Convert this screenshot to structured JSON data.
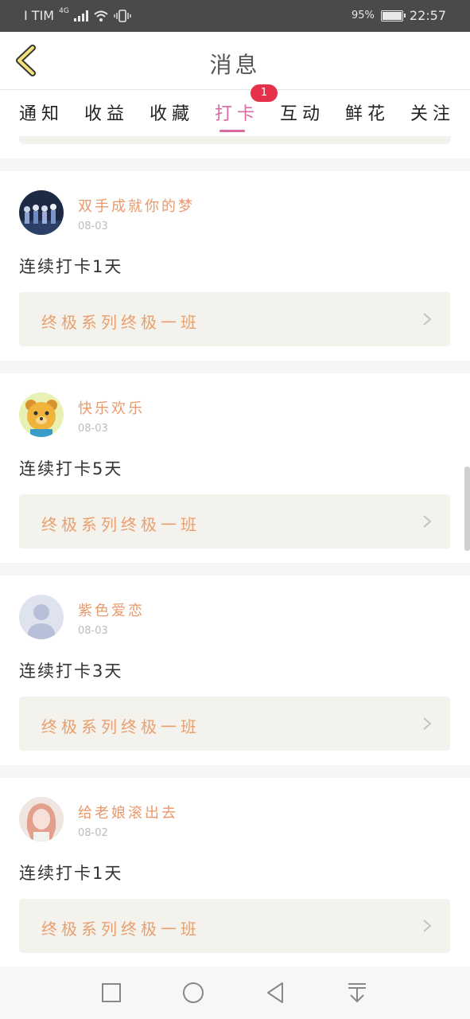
{
  "status_bar": {
    "carrier": "I TIM",
    "network": "4G",
    "battery_percent": "95%",
    "time": "22:57"
  },
  "header": {
    "title": "消息"
  },
  "tabs": [
    {
      "label": "通知",
      "active": false
    },
    {
      "label": "收益",
      "active": false
    },
    {
      "label": "收藏",
      "active": false
    },
    {
      "label": "打卡",
      "active": true
    },
    {
      "label": "互动",
      "active": false
    },
    {
      "label": "鲜花",
      "active": false
    },
    {
      "label": "关注",
      "active": false
    }
  ],
  "tab_badge": "1",
  "messages": [
    {
      "name": "双手成就你的梦",
      "date": "08-03",
      "streak": "连续打卡1天",
      "course": "终极系列终极一班"
    },
    {
      "name": "快乐欢乐",
      "date": "08-03",
      "streak": "连续打卡5天",
      "course": "终极系列终极一班"
    },
    {
      "name": "紫色爱恋",
      "date": "08-03",
      "streak": "连续打卡3天",
      "course": "终极系列终极一班"
    },
    {
      "name": "给老娘滚出去",
      "date": "08-02",
      "streak": "连续打卡1天",
      "course": "终极系列终极一班"
    }
  ],
  "icons": {
    "back": "back-chevron-icon",
    "course_arrow": "chevron-right-icon",
    "nav": [
      "square-icon",
      "circle-icon",
      "triangle-back-icon",
      "download-arrow-icon"
    ]
  },
  "colors": {
    "accent_pink": "#d96aa2",
    "name_orange": "#e89a6e",
    "badge_red": "#e6314a",
    "course_bg": "#f3f2ec"
  }
}
